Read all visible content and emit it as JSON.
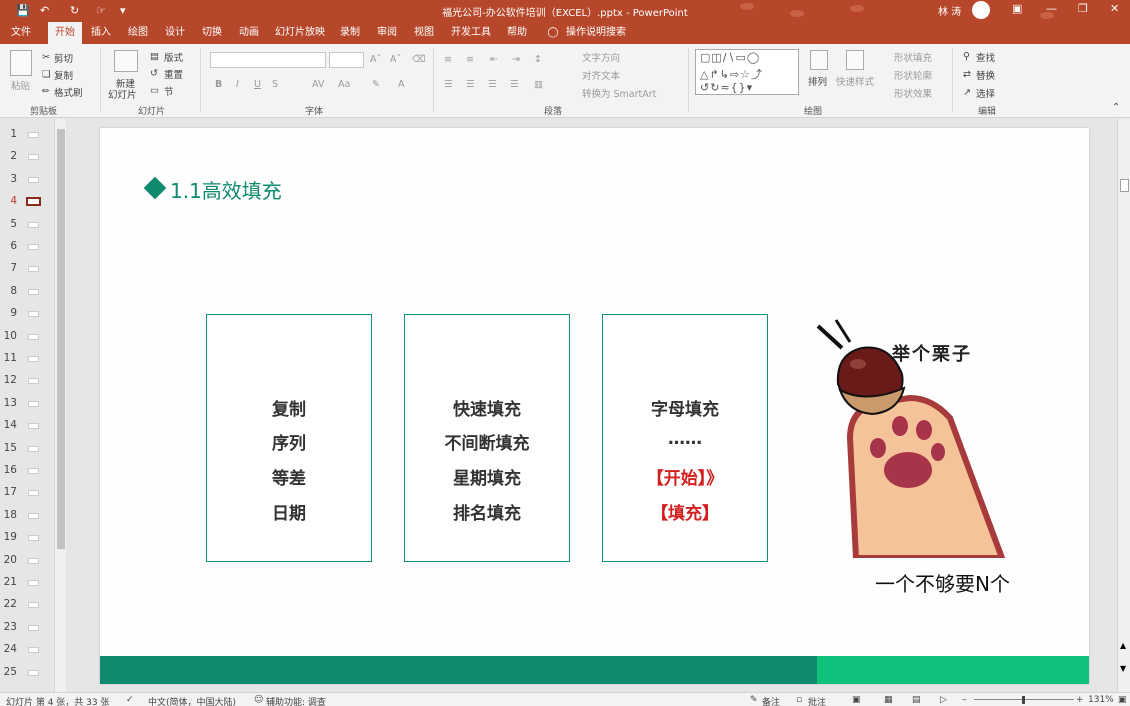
{
  "window": {
    "title": "福光公司-办公软件培训（EXCEL）.pptx  -  PowerPoint",
    "user": "林 涛"
  },
  "tabs": [
    "文件",
    "开始",
    "插入",
    "绘图",
    "设计",
    "切换",
    "动画",
    "幻灯片放映",
    "录制",
    "审阅",
    "视图",
    "开发工具",
    "帮助",
    "操作说明搜索"
  ],
  "active_tab": "开始",
  "ribbon": {
    "clipboard": {
      "paste": "粘贴",
      "cut": "剪切",
      "copy": "复制",
      "format_painter": "格式刷",
      "label": "剪贴板"
    },
    "slides": {
      "new_slide": "新建",
      "new_slide_2": "幻灯片",
      "layout": "版式",
      "reset": "重置",
      "section": "节",
      "label": "幻灯片"
    },
    "font": {
      "label": "字体",
      "bold": "B",
      "italic": "I",
      "underline": "U",
      "strike": "S",
      "spacing": "AV",
      "case": "Aa"
    },
    "paragraph": {
      "text_direction": "文字方向",
      "align_text": "对齐文本",
      "smartart": "转换为 SmartArt",
      "label": "段落"
    },
    "drawing": {
      "arrange": "排列",
      "quick_styles": "快速样式",
      "shape_fill": "形状填充",
      "shape_outline": "形状轮廓",
      "shape_effects": "形状效果",
      "label": "绘图"
    },
    "editing": {
      "find": "查找",
      "replace": "替换",
      "select": "选择",
      "label": "编辑"
    }
  },
  "thumbnails": {
    "numbers": [
      "1",
      "2",
      "3",
      "4",
      "5",
      "6",
      "7",
      "8",
      "9",
      "10",
      "11",
      "12",
      "13",
      "14",
      "15",
      "16",
      "17",
      "18",
      "19",
      "20",
      "21",
      "22",
      "23",
      "24",
      "25"
    ],
    "active": "4"
  },
  "slide": {
    "title": "1.1高效填充",
    "cards": [
      {
        "lines": [
          "复制",
          "序列",
          "等差",
          "日期"
        ],
        "red": [
          false,
          false,
          false,
          false
        ]
      },
      {
        "lines": [
          "快速填充",
          "不间断填充",
          "星期填充",
          "排名填充"
        ],
        "red": [
          false,
          false,
          false,
          false
        ]
      },
      {
        "lines": [
          "字母填充",
          "……",
          "【开始】》",
          "【填充】"
        ],
        "red": [
          false,
          false,
          true,
          true
        ]
      }
    ],
    "example_text": "举个栗子",
    "caption": "一个不够要N个",
    "colors": {
      "teal": "#0e8a6f",
      "green": "#0fc17a",
      "red": "#d21f1f"
    }
  },
  "statusbar": {
    "slide_info": "幻灯片 第 4 张，共 33 张",
    "language": "中文(简体，中国大陆)",
    "accessibility": "辅助功能: 调查",
    "notes": "备注",
    "comments": "批注",
    "zoom": "131%"
  }
}
